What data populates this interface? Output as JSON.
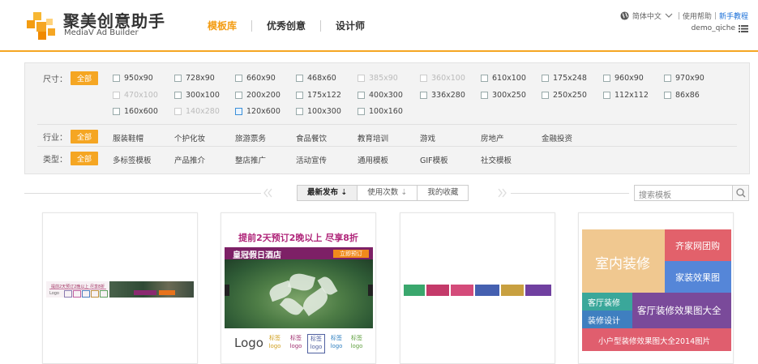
{
  "brand": {
    "title": "聚美创意助手",
    "subtitle": "MediaV Ad Builder",
    "colors": {
      "accent": "#f5a623",
      "link": "#1a6fd8"
    }
  },
  "nav": [
    {
      "label": "模板库",
      "active": true
    },
    {
      "label": "优秀创意",
      "active": false
    },
    {
      "label": "设计师",
      "active": false
    }
  ],
  "topbar": {
    "language": "简体中文",
    "help": "使用帮助",
    "tutorial": "新手教程",
    "username": "demo_qiche"
  },
  "filters": {
    "size_label": "尺寸：",
    "industry_label": "行业：",
    "type_label": "类型：",
    "all_label": "全部",
    "sizes": [
      {
        "label": "950x90",
        "state": "normal"
      },
      {
        "label": "728x90",
        "state": "normal"
      },
      {
        "label": "660x90",
        "state": "normal"
      },
      {
        "label": "468x60",
        "state": "normal"
      },
      {
        "label": "385x90",
        "state": "disabled"
      },
      {
        "label": "360x100",
        "state": "disabled"
      },
      {
        "label": "610x100",
        "state": "normal"
      },
      {
        "label": "175x248",
        "state": "normal"
      },
      {
        "label": "960x90",
        "state": "normal"
      },
      {
        "label": "970x90",
        "state": "normal"
      },
      {
        "label": "470x100",
        "state": "disabled"
      },
      {
        "label": "300x100",
        "state": "normal"
      },
      {
        "label": "200x200",
        "state": "normal"
      },
      {
        "label": "175x122",
        "state": "normal"
      },
      {
        "label": "400x300",
        "state": "normal"
      },
      {
        "label": "336x280",
        "state": "normal"
      },
      {
        "label": "300x250",
        "state": "normal"
      },
      {
        "label": "250x250",
        "state": "normal"
      },
      {
        "label": "112x112",
        "state": "normal"
      },
      {
        "label": "86x86",
        "state": "normal"
      },
      {
        "label": "160x600",
        "state": "normal"
      },
      {
        "label": "140x280",
        "state": "disabled"
      },
      {
        "label": "120x600",
        "state": "selected"
      },
      {
        "label": "100x300",
        "state": "normal"
      },
      {
        "label": "100x160",
        "state": "normal"
      }
    ],
    "industries": [
      "服装鞋帽",
      "个护化妆",
      "旅游票务",
      "食品餐饮",
      "教育培训",
      "游戏",
      "房地产",
      "金融投资"
    ],
    "types": [
      "多标签模板",
      "产品推介",
      "整店推广",
      "活动宣传",
      "通用模板",
      "GIF模板",
      "社交模板"
    ]
  },
  "sort": {
    "tabs": [
      {
        "label": "最新发布",
        "arrow": "⇣",
        "active": true
      },
      {
        "label": "使用次数",
        "arrow": "⇣",
        "active": false
      },
      {
        "label": "我的收藏",
        "arrow": "",
        "active": false
      }
    ],
    "search_placeholder": "搜索模板"
  },
  "cards": {
    "card1": {
      "headline": "提前2天预订2晚以上 尽享8折",
      "logo": "Logo"
    },
    "card2": {
      "headline": "提前2天预订2晚以上 尽享8折",
      "hotel": "皇冠假日酒店",
      "book": "立即预订",
      "logo": "Logo",
      "chips": [
        "标签",
        "标签",
        "标签",
        "标签",
        "标签"
      ],
      "chip_sub": "logo"
    },
    "card4": {
      "tiles": [
        "室内装修",
        "齐家网团购",
        "家装效果图",
        "客厅装修",
        "客厅装修效果图大全",
        "装修设计",
        "小户型装修效果图大全2014图片"
      ]
    }
  }
}
